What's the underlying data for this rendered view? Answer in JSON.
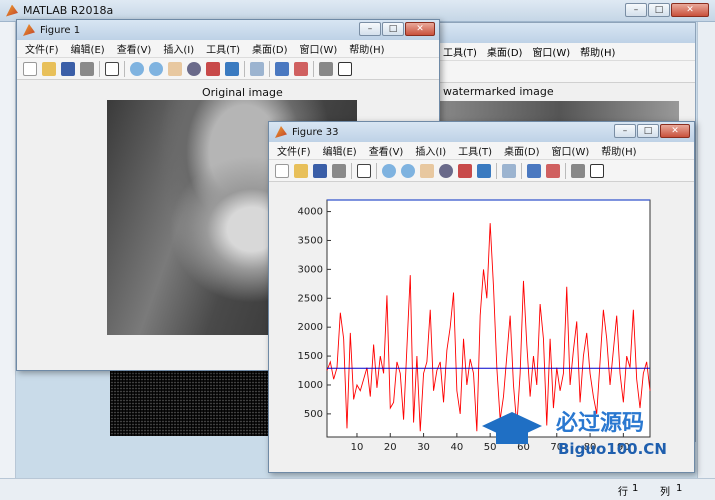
{
  "app": {
    "title": "MATLAB R2018a"
  },
  "window_controls": {
    "minimize": "–",
    "maximize": "□",
    "close": "✕"
  },
  "menu": [
    "文件(F)",
    "编辑(E)",
    "查看(V)",
    "插入(I)",
    "工具(T)",
    "桌面(D)",
    "窗口(W)",
    "帮助(H)"
  ],
  "bg_menu": [
    "工具(T)",
    "桌面(D)",
    "窗口(W)",
    "帮助(H)"
  ],
  "figure1": {
    "title": "Figure 1",
    "axes_title": "Original image"
  },
  "figure2": {
    "axes_title": "watermarked image"
  },
  "figure33": {
    "title": "Figure 33"
  },
  "logo": {
    "cn": "必过源码",
    "en": "Biguo100.CN"
  },
  "status": {
    "row_label": "行",
    "row_value": "1",
    "col_label": "列",
    "col_value": "1"
  },
  "chart_data": {
    "type": "line",
    "title": "",
    "xlabel": "",
    "ylabel": "",
    "xlim": [
      1,
      98
    ],
    "ylim": [
      100,
      4200
    ],
    "xticks": [
      10,
      20,
      30,
      40,
      50,
      60,
      70,
      80,
      90
    ],
    "yticks": [
      500,
      1000,
      1500,
      2000,
      2500,
      3000,
      3500,
      4000
    ],
    "series": [
      {
        "color": "#ff0000",
        "y": [
          1250,
          1400,
          1100,
          1300,
          2250,
          1800,
          250,
          1900,
          750,
          1000,
          900,
          1100,
          1300,
          800,
          1700,
          950,
          1500,
          1200,
          2550,
          600,
          700,
          1400,
          1200,
          400,
          1650,
          2900,
          350,
          1500,
          200,
          1200,
          1400,
          2300,
          900,
          1250,
          1400,
          700,
          1600,
          2000,
          2600,
          900,
          500,
          1800,
          1000,
          1450,
          1200,
          200,
          2200,
          3000,
          2500,
          3800,
          2700,
          1300,
          400,
          800,
          1500,
          2200,
          1000,
          300,
          1200,
          2800,
          1700,
          800,
          1500,
          1000,
          2400,
          1800,
          300,
          1800,
          600,
          1300,
          900,
          1200,
          2700,
          1000,
          1600,
          2100,
          700,
          1500,
          1900,
          1200,
          800,
          500,
          1400,
          2300,
          1800,
          1000,
          1600,
          2200,
          1200,
          700,
          1500,
          1300,
          2300,
          1100,
          600,
          1200,
          1400,
          900
        ]
      },
      {
        "color": "#0000cc",
        "y_constant": 1290
      }
    ]
  }
}
